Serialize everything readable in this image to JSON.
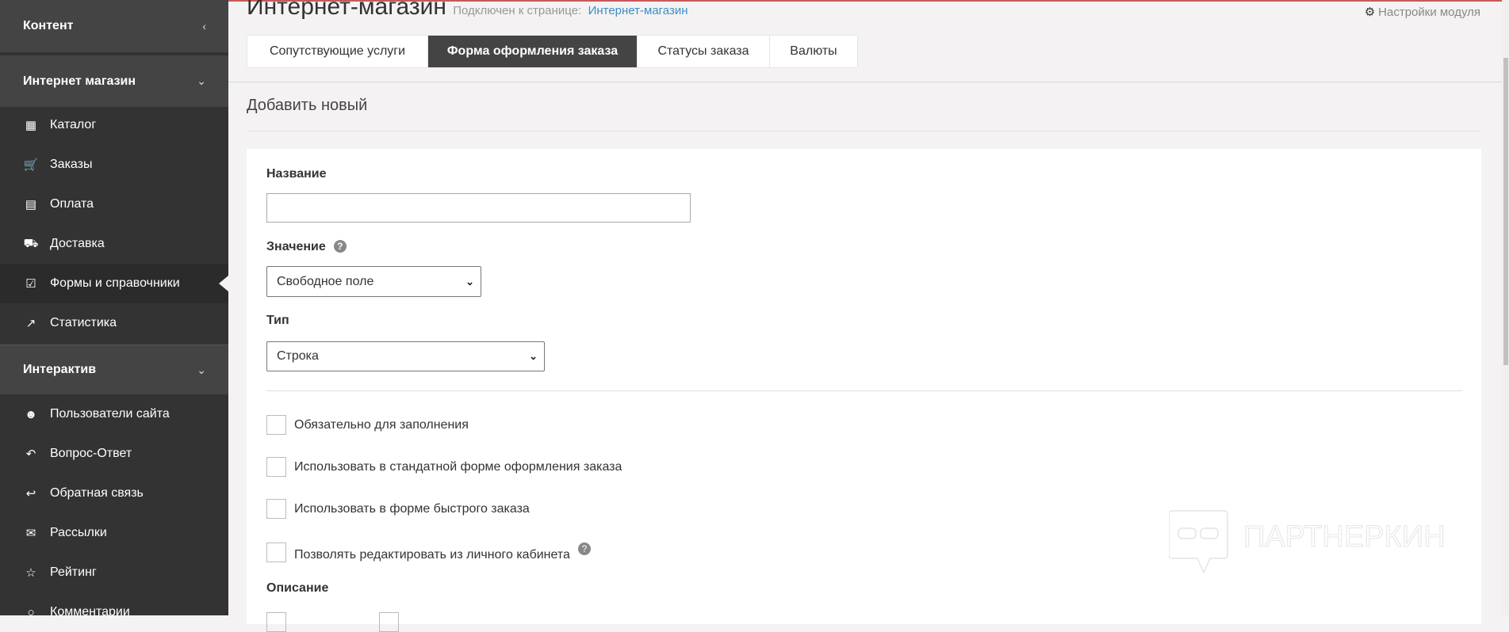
{
  "sidebar": {
    "sections": [
      {
        "label": "Контент",
        "chevron": "chevron-left-icon"
      },
      {
        "label": "Интернет магазин",
        "chevron": "chevron-down-icon"
      },
      {
        "label": "Интерактив",
        "chevron": "chevron-down-icon"
      }
    ],
    "shop_items": [
      {
        "label": "Каталог",
        "icon": "grid-icon"
      },
      {
        "label": "Заказы",
        "icon": "cart-icon"
      },
      {
        "label": "Оплата",
        "icon": "credit-card-icon"
      },
      {
        "label": "Доставка",
        "icon": "truck-icon"
      },
      {
        "label": "Формы и справочники",
        "icon": "check-square-icon",
        "active": true
      },
      {
        "label": "Статистика",
        "icon": "line-chart-icon"
      }
    ],
    "interactive_items": [
      {
        "label": "Пользователи сайта",
        "icon": "users-icon"
      },
      {
        "label": "Вопрос-Ответ",
        "icon": "reply-all-icon"
      },
      {
        "label": "Обратная связь",
        "icon": "reply-icon"
      },
      {
        "label": "Рассылки",
        "icon": "envelope-icon"
      },
      {
        "label": "Рейтинг",
        "icon": "star-icon"
      },
      {
        "label": "Комментарии",
        "icon": "comment-icon"
      }
    ]
  },
  "header": {
    "title": "Интернет-магазин",
    "connected_label": "Подключен к странице:",
    "connected_link": "Интернет-магазин",
    "settings_label": "Настройки модуля"
  },
  "tabs": [
    "Сопутствующие услуги",
    "Форма оформления заказа",
    "Статусы заказа",
    "Валюты"
  ],
  "form": {
    "heading": "Добавить новый",
    "name_label": "Название",
    "name_value": "",
    "value_label": "Значение",
    "value_selected": "Свободное поле",
    "type_label": "Тип",
    "type_selected": "Строка",
    "checkboxes": [
      "Обязательно для заполнения",
      "Использовать в стандатной форме оформления заказа",
      "Использовать в форме быстрого заказа",
      "Позволять редактировать из личного кабинета"
    ],
    "description_label": "Описание"
  },
  "watermark": "ПАРТНЕРКИН",
  "colors": {
    "sidebar": "#333333",
    "section": "#444444",
    "accent_line": "#c9595a",
    "link": "#3a8fc7"
  }
}
